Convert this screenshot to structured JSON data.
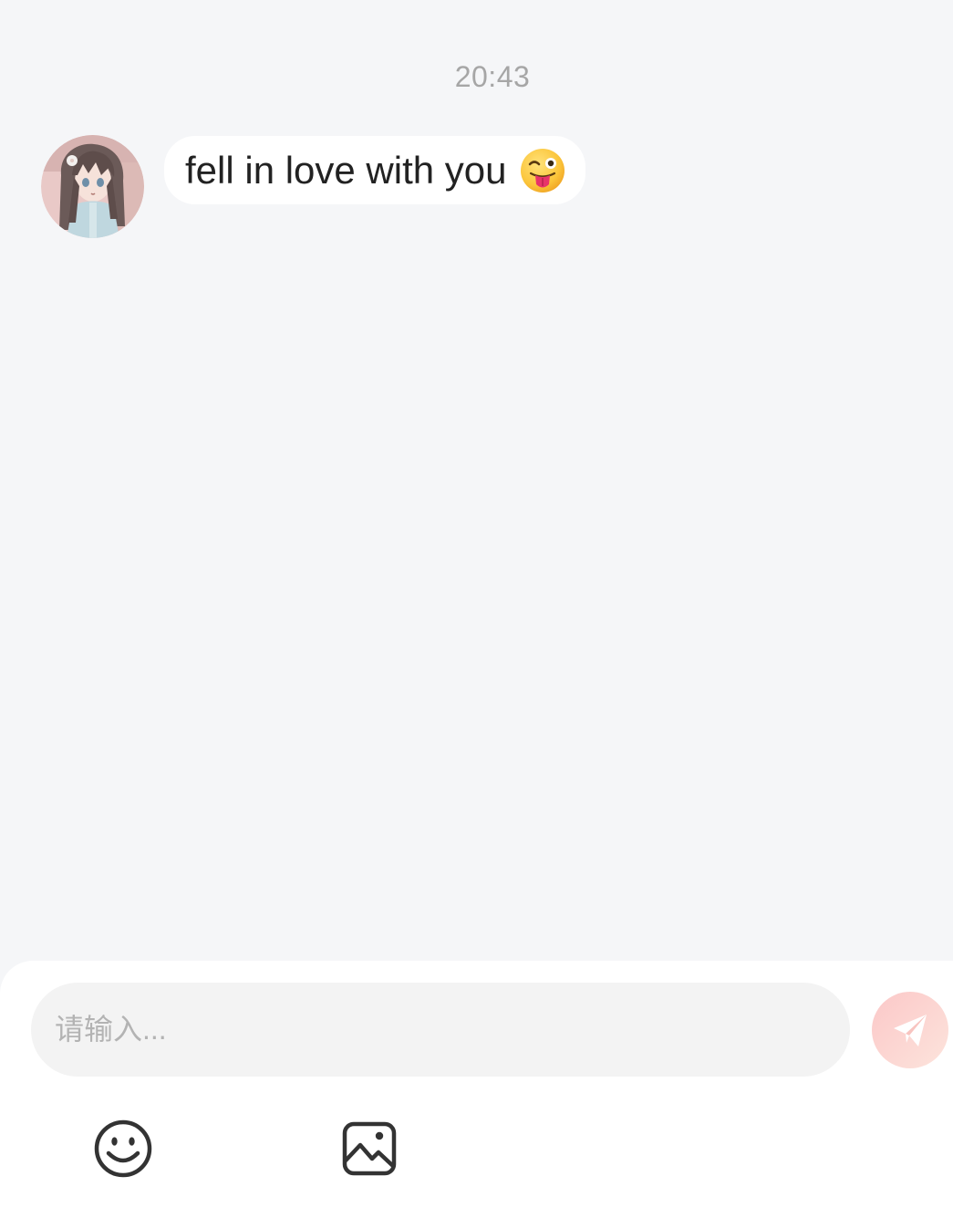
{
  "chat": {
    "timestamp": "20:43",
    "messages": [
      {
        "sender": "other",
        "text": "fell in love with you",
        "emoji": "winking-face-with-tongue-emoji"
      }
    ]
  },
  "composer": {
    "placeholder": "请输入...",
    "value": "",
    "send_icon": "paper-plane-icon",
    "tools": [
      {
        "icon": "smiley-face-icon"
      },
      {
        "icon": "image-icon"
      }
    ]
  },
  "colors": {
    "background": "#f5f6f8",
    "bubble": "#ffffff",
    "input_background": "#f3f3f3",
    "send_button": "#fbc8c8",
    "timestamp": "#a6a6a6",
    "message_text": "#222222"
  }
}
